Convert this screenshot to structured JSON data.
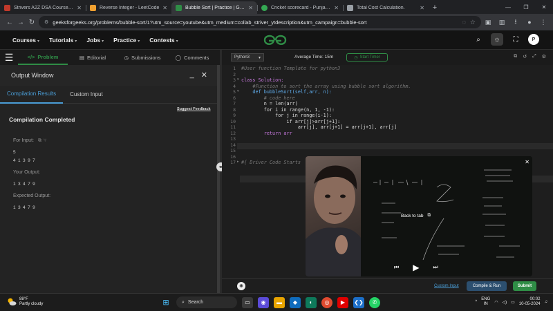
{
  "browser": {
    "tabs": [
      {
        "title": "Strivers A2Z DSA Course/Sheet",
        "favicon_color": "#c0392b",
        "active": false
      },
      {
        "title": "Reverse Integer - LeetCode",
        "favicon_color": "#f0a030",
        "active": false
      },
      {
        "title": "Bubble Sort | Practice | GeeksforGeeks",
        "favicon_color": "#2f8d46",
        "active": true
      },
      {
        "title": "Cricket scorecard - Punjab Kings",
        "favicon_color": "#34a853",
        "active": false
      },
      {
        "title": "Total Cost Calculation.",
        "favicon_color": "#9aa0a6",
        "active": false
      }
    ],
    "url": "geeksforgeeks.org/problems/bubble-sort/1?utm_source=youtube&utm_medium=collab_striver_ytdescription&utm_campaign=bubble-sort"
  },
  "nav": {
    "menu": [
      "Courses",
      "Tutorials",
      "Jobs",
      "Practice",
      "Contests"
    ],
    "avatar": "P"
  },
  "left": {
    "tabs": [
      "Problem",
      "Editorial",
      "Submissions",
      "Comments"
    ],
    "output_title": "Output Window",
    "result_tabs": [
      "Compilation Results",
      "Custom Input"
    ],
    "suggest_feedback": "Suggest Feedback",
    "status": "Compilation Completed",
    "for_input_label": "For Input:",
    "input_n": "5",
    "input_arr": "4 1 3 9 7",
    "your_output_label": "Your Output:",
    "your_output": "1 3 4 7 9",
    "expected_label": "Expected Output:",
    "expected_output": "1 3 4 7 9"
  },
  "editor": {
    "language": "Python3",
    "avg_time": "Average Time: 15m",
    "start_timer": "Start Timer",
    "line_numbers": [
      "1",
      "2",
      "3",
      "4",
      "5",
      "6",
      "7",
      "8",
      "9",
      "10",
      "11",
      "12",
      "13",
      "14",
      "15",
      "16",
      "17"
    ],
    "lines": [
      "#User function Template for python3",
      "",
      "class Solution:",
      "    #Function to sort the array using bubble sort algorithm.",
      "    def bubbleSort(self,arr, n):",
      "        # code here",
      "        n = len(arr)",
      "        for i in range(n, 1, -1):",
      "            for j in range(i-1):",
      "                if arr[j]>arr[j+1]:",
      "                    arr[j], arr[j+1] = arr[j+1], arr[j]",
      "        return arr",
      "",
      "",
      "",
      "",
      "#{ Driver Code Starts"
    ],
    "custom_input": "Custom Input",
    "compile_run": "Compile & Run",
    "submit": "Submit"
  },
  "pip": {
    "back_to_tab": "Back to tab"
  },
  "taskbar": {
    "temp": "88°F",
    "weather": "Partly cloudy",
    "search": "Search",
    "lang1": "ENG",
    "lang2": "IN",
    "time": "00:02",
    "date": "10-05-2024"
  },
  "colors": {
    "gfg_green": "#2f8d46",
    "link_blue": "#4a9dd6"
  }
}
